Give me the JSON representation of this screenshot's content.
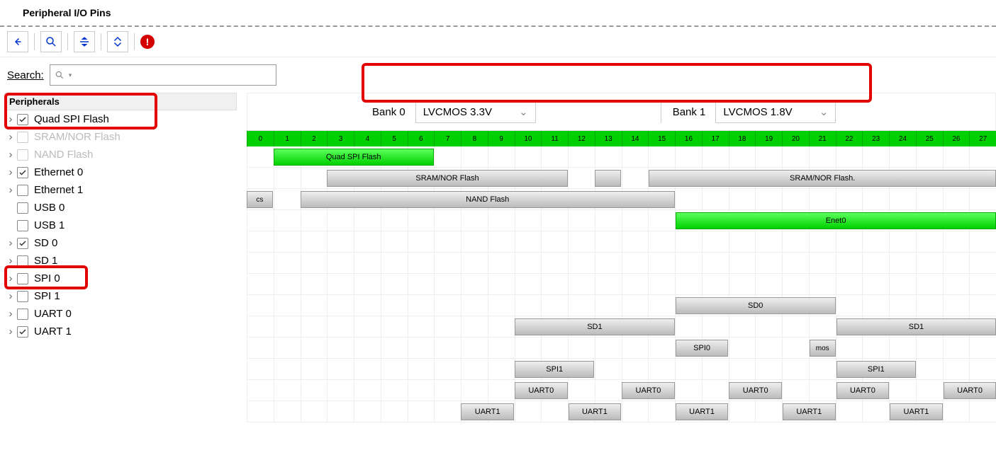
{
  "header": {
    "title": "Peripheral I/O Pins"
  },
  "search": {
    "label_underline": "S",
    "label_rest": "earch:",
    "placeholder": ""
  },
  "banks": {
    "bank0": {
      "label": "Bank 0",
      "value": "LVCMOS 3.3V"
    },
    "bank1": {
      "label": "Bank 1",
      "value": "LVCMOS 1.8V"
    }
  },
  "tree": {
    "header": "Peripherals",
    "items": [
      {
        "label": "Quad SPI Flash",
        "checked": true,
        "disabled": false,
        "expandable": true
      },
      {
        "label": "SRAM/NOR Flash",
        "checked": false,
        "disabled": true,
        "expandable": true
      },
      {
        "label": "NAND Flash",
        "checked": false,
        "disabled": true,
        "expandable": true
      },
      {
        "label": "Ethernet 0",
        "checked": true,
        "disabled": false,
        "expandable": true
      },
      {
        "label": "Ethernet 1",
        "checked": false,
        "disabled": false,
        "expandable": true
      },
      {
        "label": "USB 0",
        "checked": false,
        "disabled": false,
        "expandable": false
      },
      {
        "label": "USB 1",
        "checked": false,
        "disabled": false,
        "expandable": false
      },
      {
        "label": "SD 0",
        "checked": true,
        "disabled": false,
        "expandable": true
      },
      {
        "label": "SD 1",
        "checked": false,
        "disabled": false,
        "expandable": true
      },
      {
        "label": "SPI 0",
        "checked": false,
        "disabled": false,
        "expandable": true
      },
      {
        "label": "SPI 1",
        "checked": false,
        "disabled": false,
        "expandable": true
      },
      {
        "label": "UART 0",
        "checked": false,
        "disabled": false,
        "expandable": true
      },
      {
        "label": "UART 1",
        "checked": true,
        "disabled": false,
        "expandable": true
      }
    ]
  },
  "pins": {
    "count": 28
  },
  "rows": [
    {
      "bars": [
        {
          "label": "Quad SPI Flash",
          "start": 1,
          "span": 6,
          "color": "green"
        }
      ]
    },
    {
      "bars": [
        {
          "label": "SRAM/NOR Flash",
          "start": 3,
          "span": 9,
          "color": "gray"
        },
        {
          "label": "",
          "start": 13,
          "span": 1,
          "color": "gray"
        },
        {
          "label": "SRAM/NOR Flash.",
          "start": 15,
          "span": 13,
          "color": "gray"
        }
      ]
    },
    {
      "bars": [
        {
          "label": "cs",
          "start": 0,
          "span": 1,
          "color": "gray",
          "small": true
        },
        {
          "label": "NAND Flash",
          "start": 2,
          "span": 14,
          "color": "gray"
        }
      ]
    },
    {
      "bars": [
        {
          "label": "Enet0",
          "start": 16,
          "span": 12,
          "color": "green"
        }
      ]
    },
    {
      "bars": []
    },
    {
      "bars": []
    },
    {
      "bars": []
    },
    {
      "bars": [
        {
          "label": "SD0",
          "start": 16,
          "span": 6,
          "color": "gray"
        }
      ]
    },
    {
      "bars": [
        {
          "label": "SD1",
          "start": 10,
          "span": 6,
          "color": "gray"
        },
        {
          "label": "SD1",
          "start": 22,
          "span": 6,
          "color": "gray"
        }
      ]
    },
    {
      "bars": [
        {
          "label": "SPI0",
          "start": 16,
          "span": 2,
          "color": "gray"
        },
        {
          "label": "mos",
          "start": 21,
          "span": 1,
          "color": "gray",
          "small": true
        }
      ]
    },
    {
      "bars": [
        {
          "label": "SPI1",
          "start": 10,
          "span": 3,
          "color": "gray"
        },
        {
          "label": "SPI1",
          "start": 22,
          "span": 3,
          "color": "gray"
        }
      ]
    },
    {
      "bars": [
        {
          "label": "UART0",
          "start": 10,
          "span": 2,
          "color": "gray"
        },
        {
          "label": "UART0",
          "start": 14,
          "span": 2,
          "color": "gray"
        },
        {
          "label": "UART0",
          "start": 18,
          "span": 2,
          "color": "gray"
        },
        {
          "label": "UART0",
          "start": 22,
          "span": 2,
          "color": "gray"
        },
        {
          "label": "UART0",
          "start": 26,
          "span": 2,
          "color": "gray"
        }
      ]
    },
    {
      "bars": [
        {
          "label": "UART1",
          "start": 8,
          "span": 2,
          "color": "gray"
        },
        {
          "label": "UART1",
          "start": 12,
          "span": 2,
          "color": "gray"
        },
        {
          "label": "UART1",
          "start": 16,
          "span": 2,
          "color": "gray"
        },
        {
          "label": "UART1",
          "start": 20,
          "span": 2,
          "color": "gray"
        },
        {
          "label": "UART1",
          "start": 24,
          "span": 2,
          "color": "gray"
        }
      ]
    }
  ]
}
